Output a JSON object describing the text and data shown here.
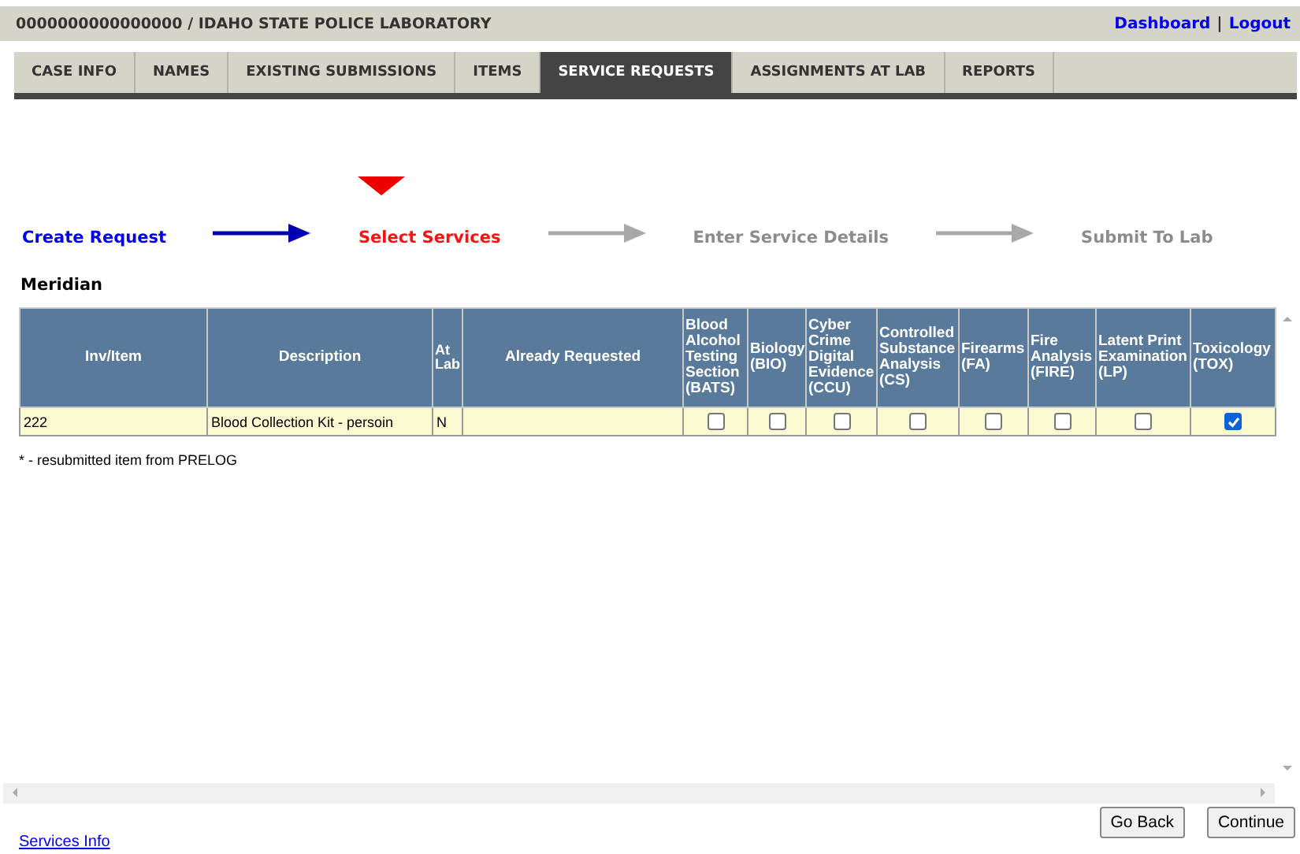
{
  "header": {
    "title": "0000000000000000 / IDAHO STATE POLICE LABORATORY",
    "links": [
      "Dashboard",
      "Logout"
    ],
    "separator": "|"
  },
  "tabs": [
    {
      "label": "CASE INFO",
      "selected": false
    },
    {
      "label": "NAMES",
      "selected": false
    },
    {
      "label": "EXISTING SUBMISSIONS",
      "selected": false
    },
    {
      "label": "ITEMS",
      "selected": false
    },
    {
      "label": "SERVICE REQUESTS",
      "selected": true
    },
    {
      "label": "ASSIGNMENTS AT LAB",
      "selected": false
    },
    {
      "label": "REPORTS",
      "selected": false
    }
  ],
  "steps": [
    {
      "label": "Create Request",
      "kind": "done"
    },
    {
      "label": "Select Services",
      "kind": "current"
    },
    {
      "label": "Enter Service Details",
      "kind": "pending"
    },
    {
      "label": "Submit To Lab",
      "kind": "pending"
    }
  ],
  "location": "Meridian",
  "table": {
    "columns": [
      "Inv/Item",
      "Description",
      "At Lab",
      "Already Requested"
    ],
    "services": [
      "Blood Alcohol Testing Section (BATS)",
      "Biology (BIO)",
      "Cyber Crime Digital Evidence (CCU)",
      "Controlled Substance Analysis (CS)",
      "Firearms (FA)",
      "Fire Analysis (FIRE)",
      "Latent Print Examination (LP)",
      "Toxicology (TOX)"
    ],
    "rows": [
      {
        "inv_item": "222",
        "description": "Blood Collection Kit - persoin",
        "at_lab": "N",
        "services": [
          {
            "checked": false
          },
          {
            "checked": false
          },
          {
            "checked": false
          },
          {
            "checked": false
          },
          {
            "checked": false
          },
          {
            "checked": false
          },
          {
            "checked": false
          },
          {
            "checked": true
          }
        ]
      }
    ]
  },
  "footnote": "* - resubmitted item from PRELOG",
  "buttons": [
    "Go Back",
    "Continue"
  ],
  "services_info_link": "Services Info"
}
